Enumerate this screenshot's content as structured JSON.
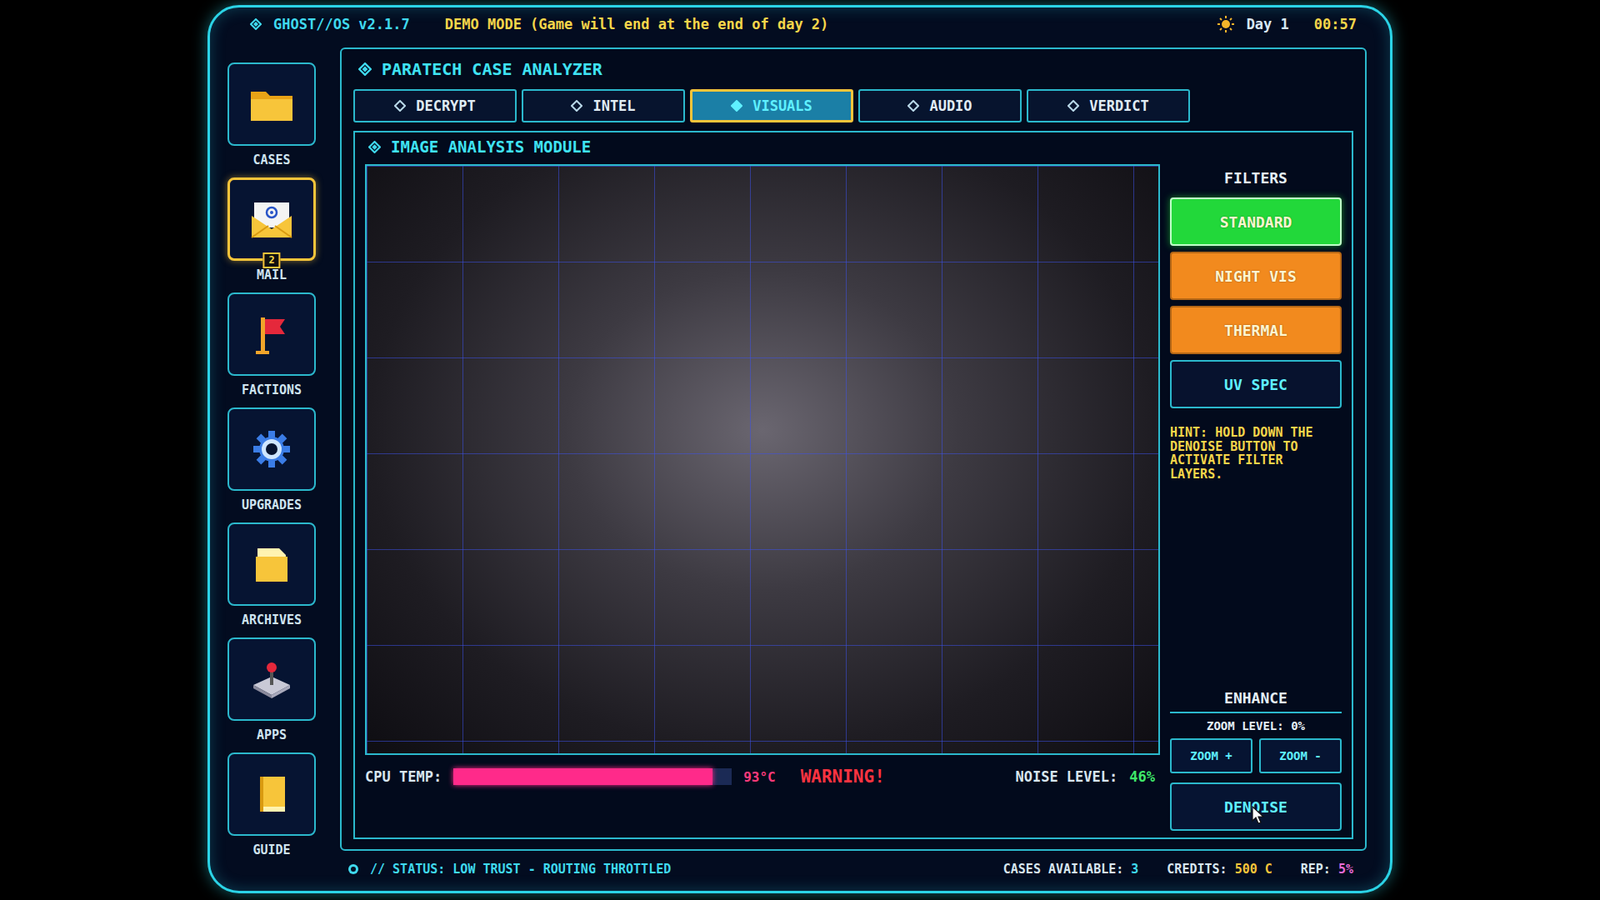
{
  "topbar": {
    "os": "GHOST//OS v2.1.7",
    "notice": "DEMO MODE (Game will end at the end of day 2)",
    "day": "Day 1",
    "time": "00:57"
  },
  "sidebar": {
    "items": [
      {
        "label": "CASES",
        "selected": false
      },
      {
        "label": "MAIL",
        "selected": true,
        "badge": "2"
      },
      {
        "label": "FACTIONS",
        "selected": false
      },
      {
        "label": "UPGRADES",
        "selected": false
      },
      {
        "label": "ARCHIVES",
        "selected": false
      },
      {
        "label": "APPS",
        "selected": false
      },
      {
        "label": "GUIDE",
        "selected": false
      }
    ]
  },
  "panel": {
    "title": "PARATECH CASE ANALYZER"
  },
  "tabs": [
    {
      "label": "DECRYPT",
      "selected": false
    },
    {
      "label": "INTEL",
      "selected": false
    },
    {
      "label": "VISUALS",
      "selected": true
    },
    {
      "label": "AUDIO",
      "selected": false
    },
    {
      "label": "VERDICT",
      "selected": false
    }
  ],
  "module": {
    "title": "IMAGE ANALYSIS MODULE"
  },
  "filters": {
    "title": "FILTERS",
    "items": [
      {
        "label": "STANDARD",
        "selected": true,
        "color": "#22d83a"
      },
      {
        "label": "NIGHT VIS",
        "selected": false,
        "color": "#f28a1e"
      },
      {
        "label": "THERMAL",
        "selected": false,
        "color": "#f28a1e"
      },
      {
        "label": "UV SPEC",
        "selected": false,
        "color": "#07122e"
      }
    ]
  },
  "hint": "HINT: HOLD DOWN THE DENOISE BUTTON TO ACTIVATE FILTER LAYERS.",
  "enhance": {
    "title": "ENHANCE",
    "zoom_level": "ZOOM LEVEL: 0%",
    "buttons": [
      "ZOOM +",
      "ZOOM -"
    ],
    "denoise": "DENOISE"
  },
  "cpu": {
    "label": "CPU TEMP:",
    "level": 0.93,
    "reading": "93°C",
    "warning": "WARNING!"
  },
  "noise": {
    "label": "NOISE LEVEL:",
    "value": "46%"
  },
  "status_bar": {
    "status": "// STATUS: LOW TRUST - ROUTING THROTTLED",
    "cases": {
      "label": "CASES AVAILABLE:",
      "value": "3"
    },
    "credits": {
      "label": "CREDITS:",
      "value": "500 C"
    },
    "rep": {
      "label": "REP:",
      "value": "5%"
    }
  }
}
